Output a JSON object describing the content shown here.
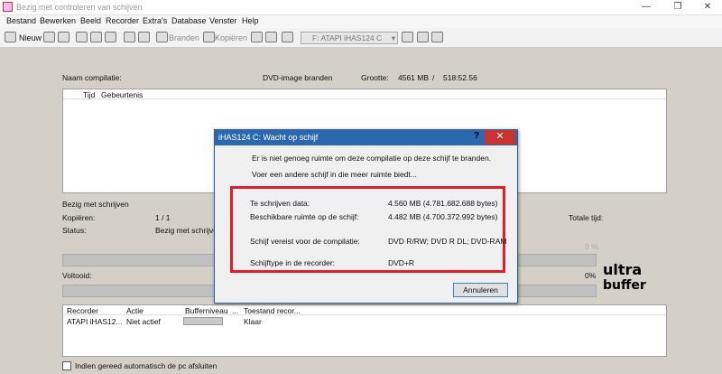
{
  "window": {
    "title": "Bezig met controleren van schijven",
    "minimize": "—",
    "restore": "❐",
    "close": "✕"
  },
  "menu": [
    "Bestand",
    "Bewerken",
    "Beeld",
    "Recorder",
    "Extra's",
    "Database",
    "Venster",
    "Help"
  ],
  "toolbar": {
    "new_label": "Nieuw",
    "burn_label": "Branden",
    "copy_label": "Kopiëren",
    "drive_value": "F: ATAPI iHAS124   C"
  },
  "compilation": {
    "name_label": "Naam compilatie:",
    "type": "DVD-image branden",
    "size_label": "Grootte:",
    "size_mb": "4561 MB",
    "separator": "/",
    "duration": "518:52.56"
  },
  "event_columns": [
    "Tijd",
    "Gebeurtenis"
  ],
  "progress": {
    "writing_label": "Bezig met schrijven",
    "copies_label": "Kopiëren:",
    "copies_value": "1 / 1",
    "status_label": "Status:",
    "status_value": "Bezig met schrijven",
    "total_time_label": "Totale tijd:",
    "overall_percent_text": "0 %",
    "done_label": "Voltooid:",
    "done_percent_text": "0%"
  },
  "recorders": {
    "columns": [
      "Recorder",
      "Actie",
      "Bufferniveau",
      "...",
      "Toestand recor..."
    ],
    "rows": [
      {
        "recorder": "ATAPI iHAS12...",
        "action": "Niet actief",
        "state": "Klaar"
      }
    ]
  },
  "auto_shutdown_label": "Indien gereed automatisch de pc afsluiten",
  "dialog": {
    "title": "iHAS124   C: Wacht op schijf",
    "help": "?",
    "close": "✕",
    "message1": "Er is niet genoeg ruimte om deze compilatie op deze schijf te branden.",
    "message2": "Voer een andere schijf in die meer ruimte biedt...",
    "info": [
      {
        "label": "Te schrijven data:",
        "value": "4.560 MB (4.781.682.688 bytes)"
      },
      {
        "label": "Beschikbare ruimte op de schijf:",
        "value": "4.482 MB (4.700.372.992 bytes)"
      },
      {
        "label": "Schijf vereist voor de compilatie:",
        "value": "DVD R/RW; DVD R DL; DVD-RAM"
      },
      {
        "label": "Schijftype in de recorder:",
        "value": "DVD+R"
      }
    ],
    "cancel_label": "Annuleren"
  },
  "logo_text": [
    "ultra",
    "buffer"
  ],
  "colors": {
    "dialog_title_bg": "#2b68b0",
    "highlight_border": "#e21c2a",
    "close_red": "#c7332f"
  }
}
